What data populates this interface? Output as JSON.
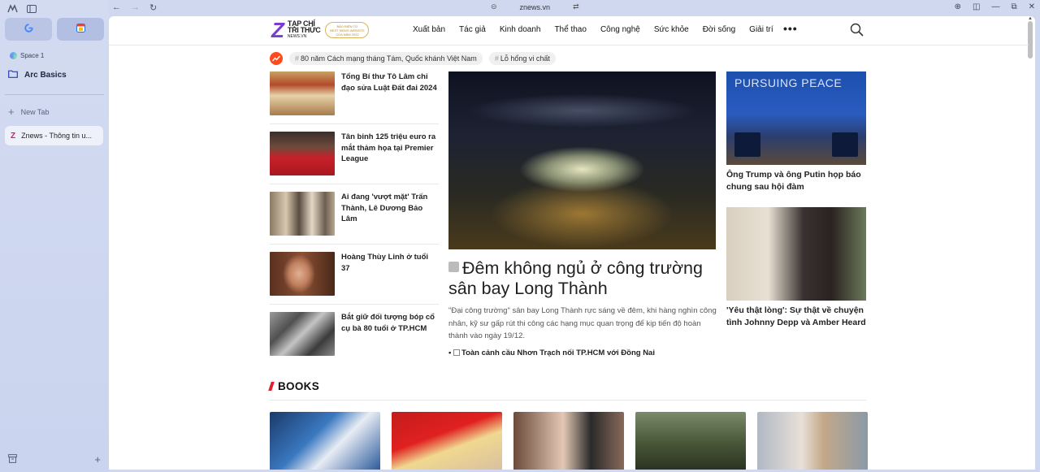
{
  "browser": {
    "space_label": "Space 1",
    "folder_label": "Arc Basics",
    "new_tab_label": "New Tab",
    "active_tab_title": "Znews - Thông tin u...",
    "url": "znews.vn"
  },
  "site": {
    "logo_letter": "Z",
    "logo_line1": "TẠP CHÍ",
    "logo_line2": "TRI THỨC",
    "logo_line3": "NEWS.VN",
    "award_line1": "BÁO ĐIỆN TỬ",
    "award_line2": "BEST NEWS WEBSITE",
    "award_line3": "CỦA NĂM 2022",
    "nav": [
      "Xuất bản",
      "Tác giả",
      "Kinh doanh",
      "Thể thao",
      "Công nghệ",
      "Sức khỏe",
      "Đời sống",
      "Giải trí"
    ],
    "more": "•••",
    "tags": [
      "80 năm Cách mạng tháng Tám, Quốc khánh Việt Nam",
      "Lỗ hổng vi chất"
    ]
  },
  "left_list": [
    {
      "title": "Tổng Bí thư Tô Lâm chỉ đạo sửa Luật Đất đai 2024"
    },
    {
      "title": "Tân binh 125 triệu euro ra mắt thảm họa tại Premier League"
    },
    {
      "title": "Ai đang 'vượt mặt' Trấn Thành, Lê Dương Bảo Lâm"
    },
    {
      "title": "Hoàng Thùy Linh ở tuổi 37"
    },
    {
      "title": "Bắt giữ đối tượng bóp cổ cụ bà 80 tuổi ở TP.HCM"
    }
  ],
  "hero": {
    "title": "Đêm không ngủ ở công trường sân bay Long Thành",
    "description": "\"Đại công trường\" sân bay Long Thành rực sáng về đêm, khi hàng nghìn công nhân, kỹ sư gấp rút thi công các hạng mục quan trọng để kịp tiến độ hoàn thành vào ngày 19/12.",
    "related": "Toàn cảnh cầu Nhơn Trạch nối TP.HCM với Đồng Nai"
  },
  "right_column": [
    {
      "title": "Ông Trump và ông Putin họp báo chung sau hội đàm",
      "image_caption": "PURSUING PEACE"
    },
    {
      "title": "'Yêu thật lòng': Sự thật về chuyện tình Johnny Depp và Amber Heard"
    }
  ],
  "books": {
    "section_label": "BOOKS"
  }
}
